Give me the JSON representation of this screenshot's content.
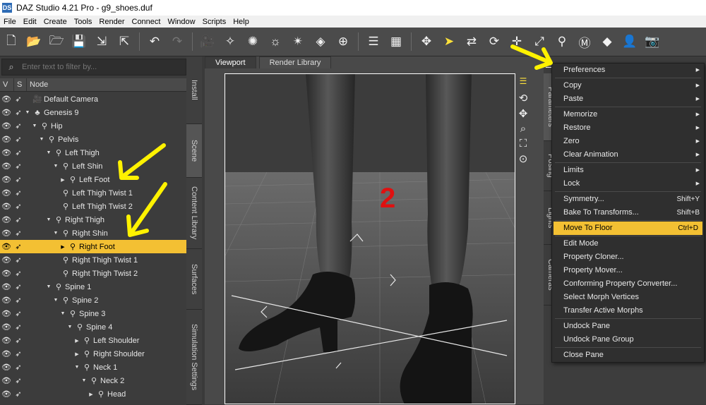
{
  "window": {
    "title": "DAZ Studio 4.21 Pro - g9_shoes.duf",
    "logo": "DS"
  },
  "menubar": [
    "File",
    "Edit",
    "Create",
    "Tools",
    "Render",
    "Connect",
    "Window",
    "Scripts",
    "Help"
  ],
  "scene": {
    "filter_placeholder": "Enter text to filter by...",
    "columns": {
      "v": "V",
      "s": "S",
      "node": "Node"
    },
    "nodes": [
      {
        "label": "Default Camera",
        "depth": 0,
        "arrow": "",
        "icon": "camera-icon"
      },
      {
        "label": "Genesis 9",
        "depth": 0,
        "arrow": "down",
        "icon": "figure-icon"
      },
      {
        "label": "Hip",
        "depth": 1,
        "arrow": "down",
        "icon": "bone-icon"
      },
      {
        "label": "Pelvis",
        "depth": 2,
        "arrow": "down",
        "icon": "bone-icon"
      },
      {
        "label": "Left Thigh",
        "depth": 3,
        "arrow": "down",
        "icon": "bone-icon"
      },
      {
        "label": "Left Shin",
        "depth": 4,
        "arrow": "down",
        "icon": "bone-icon"
      },
      {
        "label": "Left Foot",
        "depth": 5,
        "arrow": "right",
        "icon": "bone-icon"
      },
      {
        "label": "Left Thigh Twist 1",
        "depth": 4,
        "arrow": "",
        "icon": "bone-icon"
      },
      {
        "label": "Left Thigh Twist 2",
        "depth": 4,
        "arrow": "",
        "icon": "bone-icon"
      },
      {
        "label": "Right Thigh",
        "depth": 3,
        "arrow": "down",
        "icon": "bone-icon"
      },
      {
        "label": "Right Shin",
        "depth": 4,
        "arrow": "down",
        "icon": "bone-icon"
      },
      {
        "label": "Right Foot",
        "depth": 5,
        "arrow": "right",
        "icon": "bone-icon",
        "selected": true
      },
      {
        "label": "Right Thigh Twist 1",
        "depth": 4,
        "arrow": "",
        "icon": "bone-icon"
      },
      {
        "label": "Right Thigh Twist 2",
        "depth": 4,
        "arrow": "",
        "icon": "bone-icon"
      },
      {
        "label": "Spine 1",
        "depth": 3,
        "arrow": "down",
        "icon": "bone-icon"
      },
      {
        "label": "Spine 2",
        "depth": 4,
        "arrow": "down",
        "icon": "bone-icon"
      },
      {
        "label": "Spine 3",
        "depth": 5,
        "arrow": "down",
        "icon": "bone-icon"
      },
      {
        "label": "Spine 4",
        "depth": 6,
        "arrow": "down",
        "icon": "bone-icon"
      },
      {
        "label": "Left Shoulder",
        "depth": 7,
        "arrow": "right",
        "icon": "bone-icon"
      },
      {
        "label": "Right Shoulder",
        "depth": 7,
        "arrow": "right",
        "icon": "bone-icon"
      },
      {
        "label": "Neck 1",
        "depth": 7,
        "arrow": "down",
        "icon": "bone-icon"
      },
      {
        "label": "Neck 2",
        "depth": 8,
        "arrow": "down",
        "icon": "bone-icon"
      },
      {
        "label": "Head",
        "depth": 9,
        "arrow": "right",
        "icon": "bone-icon"
      }
    ]
  },
  "left_tabs": [
    "Install",
    "Scene",
    "Content Library",
    "Surfaces",
    "Simulation Settings"
  ],
  "viewport": {
    "tabs": [
      "Viewport",
      "Render Library"
    ],
    "annotation": "2"
  },
  "right_tabs": [
    "Parameters",
    "Posing",
    "Lights",
    "Cameras"
  ],
  "context_menu": [
    {
      "label": "Preferences",
      "submenu": true
    },
    {
      "sep": true
    },
    {
      "label": "Copy",
      "submenu": true
    },
    {
      "label": "Paste",
      "submenu": true
    },
    {
      "sep": true
    },
    {
      "label": "Memorize",
      "submenu": true
    },
    {
      "label": "Restore",
      "submenu": true
    },
    {
      "label": "Zero",
      "submenu": true
    },
    {
      "label": "Clear Animation",
      "submenu": true
    },
    {
      "sep": true
    },
    {
      "label": "Limits",
      "submenu": true
    },
    {
      "label": "Lock",
      "submenu": true
    },
    {
      "sep": true
    },
    {
      "label": "Symmetry...",
      "shortcut": "Shift+Y"
    },
    {
      "label": "Bake To Transforms...",
      "shortcut": "Shift+B"
    },
    {
      "sep": true
    },
    {
      "label": "Move To Floor",
      "shortcut": "Ctrl+D",
      "highlighted": true
    },
    {
      "sep": true
    },
    {
      "label": "Edit Mode"
    },
    {
      "label": "Property Cloner..."
    },
    {
      "label": "Property Mover..."
    },
    {
      "label": "Conforming Property Converter..."
    },
    {
      "label": "Select Morph Vertices"
    },
    {
      "label": "Transfer Active Morphs"
    },
    {
      "sep": true
    },
    {
      "label": "Undock Pane"
    },
    {
      "label": "Undock Pane Group"
    },
    {
      "sep": true
    },
    {
      "label": "Close Pane"
    }
  ],
  "colors": {
    "highlight": "#f3c033",
    "arrow": "#fff200",
    "annotation": "#e01010"
  }
}
